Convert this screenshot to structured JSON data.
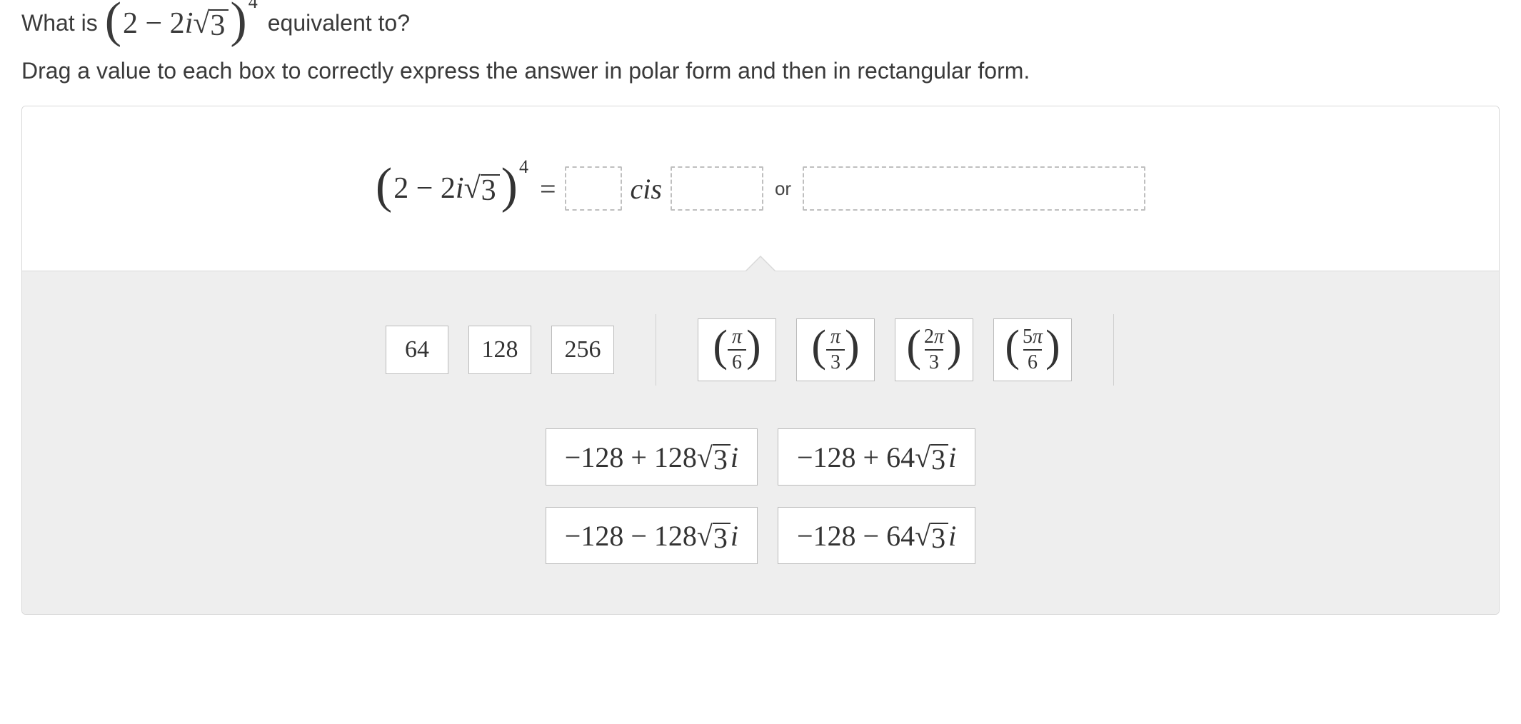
{
  "question": {
    "prefix": "What is ",
    "expr_open": "(",
    "expr_base": "2 − 2",
    "expr_i": "i",
    "expr_sqrt": "√",
    "expr_sqrt_arg": "3",
    "expr_close": ")",
    "expr_exp": "4",
    "suffix": " equivalent to?",
    "instruction": "Drag a value to each box to correctly express the answer in polar form and then in rectangular form."
  },
  "equation": {
    "equals": "=",
    "cis": "cis",
    "or": "or"
  },
  "tiles": {
    "numbers": [
      "64",
      "128",
      "256"
    ],
    "fractions": [
      {
        "num": "π",
        "den": "6"
      },
      {
        "num": "π",
        "den": "3"
      },
      {
        "num": "2π",
        "den": "3"
      },
      {
        "num": "5π",
        "den": "6"
      }
    ],
    "rectangular": [
      {
        "a": "−128 + 128",
        "sqrt": "3",
        "i": "i"
      },
      {
        "a": "−128 + 64",
        "sqrt": "3",
        "i": "i"
      },
      {
        "a": "−128 − 128",
        "sqrt": "3",
        "i": "i"
      },
      {
        "a": "−128 − 64",
        "sqrt": "3",
        "i": "i"
      }
    ]
  }
}
